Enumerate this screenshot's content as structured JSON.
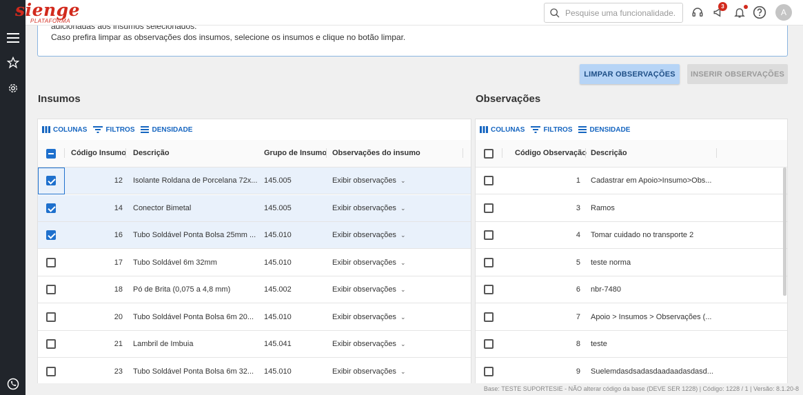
{
  "app": {
    "brand": "sienge",
    "brand_sub": "PLATAFORMA"
  },
  "topbar": {
    "search_placeholder": "Pesquise uma funcionalidade.",
    "notifications_count": "3",
    "avatar_letter": "A"
  },
  "info": {
    "line1": "adicionadas aos insumos selecionados.",
    "line2": "Caso prefira limpar as observações dos insumos, selecione os insumos e clique no botão limpar."
  },
  "actions": {
    "clear_label": "LIMPAR OBSERVAÇÕES",
    "insert_label": "INSERIR OBSERVAÇÕES"
  },
  "insumos": {
    "title": "Insumos",
    "toolbar": {
      "columns": "COLUNAS",
      "filters": "FILTROS",
      "density": "DENSIDADE"
    },
    "headers": {
      "code": "Código Insumo",
      "description": "Descrição",
      "group": "Grupo de Insumo",
      "observations": "Observações do insumo"
    },
    "rows": [
      {
        "code": "12",
        "description": "Isolante Roldana de Porcelana 72x...",
        "group": "145.005",
        "obs": "Exibir observações",
        "checked": true
      },
      {
        "code": "14",
        "description": "Conector Bimetal",
        "group": "145.005",
        "obs": "Exibir observações",
        "checked": true
      },
      {
        "code": "16",
        "description": "Tubo Soldável Ponta Bolsa 25mm ...",
        "group": "145.010",
        "obs": "Exibir observações",
        "checked": true
      },
      {
        "code": "17",
        "description": "Tubo Soldável 6m 32mm",
        "group": "145.010",
        "obs": "Exibir observações",
        "checked": false
      },
      {
        "code": "18",
        "description": "Pó de Brita (0,075 a 4,8 mm)",
        "group": "145.002",
        "obs": "Exibir observações",
        "checked": false
      },
      {
        "code": "20",
        "description": "Tubo Soldável Ponta Bolsa 6m 20...",
        "group": "145.010",
        "obs": "Exibir observações",
        "checked": false
      },
      {
        "code": "21",
        "description": "Lambril de Imbuia",
        "group": "145.041",
        "obs": "Exibir observações",
        "checked": false
      },
      {
        "code": "23",
        "description": "Tubo Soldável Ponta Bolsa 6m 32...",
        "group": "145.010",
        "obs": "Exibir observações",
        "checked": false
      }
    ]
  },
  "observacoes": {
    "title": "Observações",
    "toolbar": {
      "columns": "COLUNAS",
      "filters": "FILTROS",
      "density": "DENSIDADE"
    },
    "headers": {
      "code": "Código Observação",
      "description": "Descrição"
    },
    "rows": [
      {
        "code": "1",
        "description": "Cadastrar em Apoio>Insumo>Obs..."
      },
      {
        "code": "3",
        "description": "Ramos"
      },
      {
        "code": "4",
        "description": "Tomar cuidado no transporte 2"
      },
      {
        "code": "5",
        "description": "teste norma"
      },
      {
        "code": "6",
        "description": "nbr-7480"
      },
      {
        "code": "7",
        "description": "Apoio > Insumos > Observações (..."
      },
      {
        "code": "8",
        "description": "teste"
      },
      {
        "code": "9",
        "description": "Suelemdasdsadasdaadaadasdasd..."
      }
    ]
  },
  "footer": {
    "text": "Base: TESTE SUPORTESIE - NÃO alterar código da base (DEVE SER 1228) | Código: 1228 / 1 | Versão: 8.1.20-8"
  },
  "colors": {
    "brand": "#d22a1d",
    "accent": "#1e70cd",
    "sidebar": "#21252b"
  }
}
